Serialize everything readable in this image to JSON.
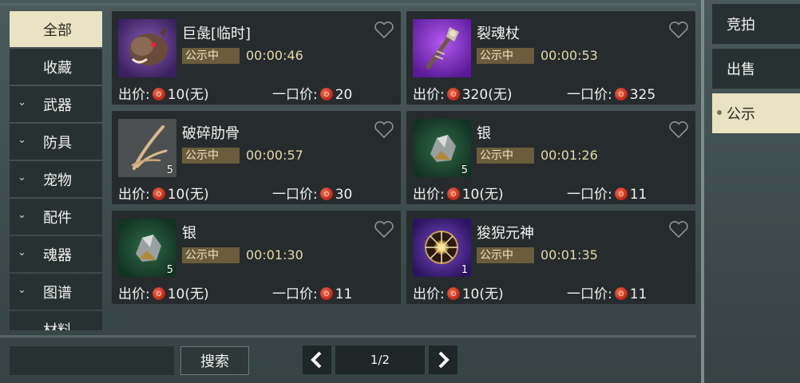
{
  "sidebar": {
    "items": [
      {
        "label": "全部",
        "active": true,
        "chevron": false
      },
      {
        "label": "收藏",
        "active": false,
        "chevron": false
      },
      {
        "label": "武器",
        "active": false,
        "chevron": true
      },
      {
        "label": "防具",
        "active": false,
        "chevron": true
      },
      {
        "label": "宠物",
        "active": false,
        "chevron": true
      },
      {
        "label": "配件",
        "active": false,
        "chevron": true
      },
      {
        "label": "魂器",
        "active": false,
        "chevron": true
      },
      {
        "label": "图谱",
        "active": false,
        "chevron": true
      },
      {
        "label": "材料",
        "active": false,
        "chevron": false
      }
    ]
  },
  "right_tabs": [
    {
      "label": "竞拍",
      "active": false
    },
    {
      "label": "出售",
      "active": false
    },
    {
      "label": "公示",
      "active": true
    }
  ],
  "price_labels": {
    "bid": "出价:",
    "buyout": "一口价:",
    "none": "(无)"
  },
  "items": [
    {
      "name": "巨彘[临时]",
      "icon": "boar-icon",
      "icon_bg": "#5b3a8a",
      "qty": "",
      "status": "公示中",
      "timer": "00:00:46",
      "bid": "10",
      "buyout": "20"
    },
    {
      "name": "裂魂杖",
      "icon": "staff-icon",
      "icon_bg": "#8a2fd0",
      "qty": "",
      "status": "公示中",
      "timer": "00:00:53",
      "bid": "320",
      "buyout": "325"
    },
    {
      "name": "破碎肋骨",
      "icon": "rib-bone-icon",
      "icon_bg": "#4a4c4c",
      "qty": "5",
      "status": "公示中",
      "timer": "00:00:57",
      "bid": "10",
      "buyout": "30"
    },
    {
      "name": "银",
      "icon": "silver-ore-icon",
      "icon_bg": "#1f4a32",
      "qty": "5",
      "status": "公示中",
      "timer": "00:01:26",
      "bid": "10",
      "buyout": "11"
    },
    {
      "name": "银",
      "icon": "silver-ore-icon",
      "icon_bg": "#1f4a32",
      "qty": "5",
      "status": "公示中",
      "timer": "00:01:30",
      "bid": "10",
      "buyout": "11"
    },
    {
      "name": "狻猊元神",
      "icon": "spirit-orb-icon",
      "icon_bg": "#5a2fa0",
      "qty": "1",
      "status": "公示中",
      "timer": "00:01:35",
      "bid": "10",
      "buyout": "11"
    }
  ],
  "search": {
    "value": "",
    "button_label": "搜索"
  },
  "pagination": {
    "page": "1/2"
  },
  "colors": {
    "accent": "#e9e3c3",
    "coin": "#c9321e",
    "status_bg": "#6b5d3c"
  }
}
